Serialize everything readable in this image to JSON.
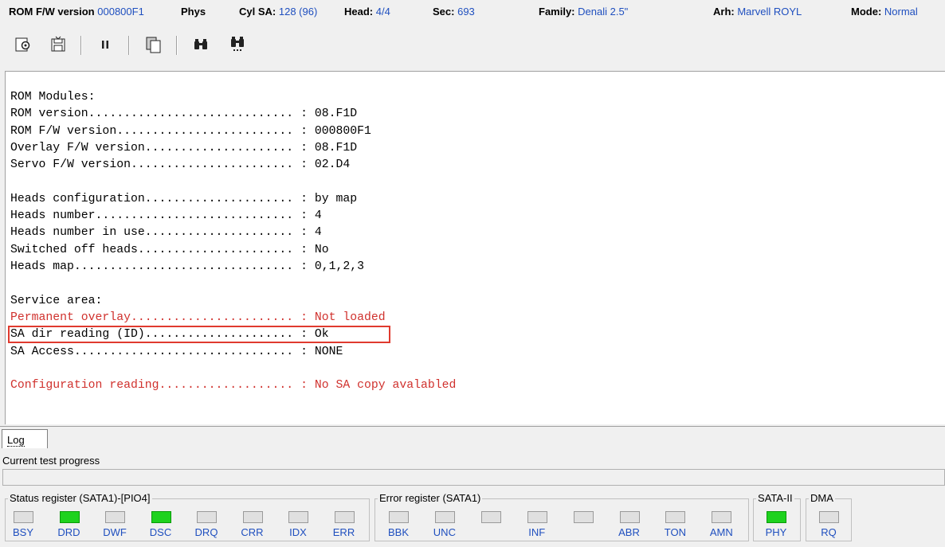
{
  "info": {
    "rom_fw_label": "ROM F/W version",
    "rom_fw_value": "000800F1",
    "phys_label": "Phys",
    "cylsa_label": "Cyl SA:",
    "cylsa_value": "128 (96)",
    "head_label": "Head:",
    "head_value": "4/4",
    "sec_label": "Sec:",
    "sec_value": "693",
    "family_label": "Family:",
    "family_value": "Denali 2.5\"",
    "arh_label": "Arh:",
    "arh_value": "Marvell ROYL",
    "mode_label": "Mode:",
    "mode_value": "Normal"
  },
  "toolbar": {
    "buttons": [
      {
        "name": "settings-icon",
        "glyph": "⚙"
      },
      {
        "name": "save-icon",
        "glyph": "💾"
      },
      {
        "name": "pause-icon",
        "glyph": "⏸"
      },
      {
        "name": "copy-icon",
        "glyph": "❐"
      },
      {
        "name": "binoculars-icon",
        "glyph": "🔭"
      },
      {
        "name": "binoculars-next-icon",
        "glyph": "🔭"
      }
    ]
  },
  "output": {
    "lines": [
      {
        "text": "ROM Modules:",
        "color": "#000000"
      },
      {
        "text": "ROM version............................. : 08.F1D",
        "color": "#000000"
      },
      {
        "text": "ROM F/W version......................... : 000800F1",
        "color": "#000000"
      },
      {
        "text": "Overlay F/W version..................... : 08.F1D",
        "color": "#000000"
      },
      {
        "text": "Servo F/W version....................... : 02.D4",
        "color": "#000000"
      },
      {
        "text": "",
        "color": "#000000"
      },
      {
        "text": "Heads configuration..................... : by map",
        "color": "#000000"
      },
      {
        "text": "Heads number............................ : 4",
        "color": "#000000"
      },
      {
        "text": "Heads number in use..................... : 4",
        "color": "#000000"
      },
      {
        "text": "Switched off heads...................... : No",
        "color": "#000000"
      },
      {
        "text": "Heads map............................... : 0,1,2,3",
        "color": "#000000"
      },
      {
        "text": "",
        "color": "#000000"
      },
      {
        "text": "Service area:",
        "color": "#000000"
      },
      {
        "text": "Permanent overlay....................... : Not loaded",
        "color": "#d0312d"
      },
      {
        "text": "SA dir reading (ID)..................... : Ok",
        "color": "#000000"
      },
      {
        "text": "SA Access............................... : NONE",
        "color": "#000000"
      },
      {
        "text": "",
        "color": "#000000"
      },
      {
        "text": "Configuration reading................... : No SA copy avalabled",
        "color": "#d0312d"
      }
    ]
  },
  "tabs": {
    "log_label": "Log"
  },
  "progress": {
    "label": "Current test progress",
    "value": 0
  },
  "status_register": {
    "title": "Status register (SATA1)-[PIO4]",
    "leds": [
      {
        "label": "BSY",
        "on": false
      },
      {
        "label": "DRD",
        "on": true
      },
      {
        "label": "DWF",
        "on": false
      },
      {
        "label": "DSC",
        "on": true
      },
      {
        "label": "DRQ",
        "on": false
      },
      {
        "label": "CRR",
        "on": false
      },
      {
        "label": "IDX",
        "on": false
      },
      {
        "label": "ERR",
        "on": false
      }
    ]
  },
  "error_register": {
    "title": "Error register (SATA1)",
    "leds": [
      {
        "label": "BBK",
        "on": false
      },
      {
        "label": "UNC",
        "on": false
      },
      {
        "label": "",
        "on": false
      },
      {
        "label": "INF",
        "on": false
      },
      {
        "label": "",
        "on": false
      },
      {
        "label": "ABR",
        "on": false
      },
      {
        "label": "TON",
        "on": false
      },
      {
        "label": "AMN",
        "on": false
      }
    ]
  },
  "sata": {
    "title": "SATA-II",
    "leds": [
      {
        "label": "PHY",
        "on": true
      }
    ]
  },
  "dma": {
    "title": "DMA",
    "leds": [
      {
        "label": "RQ",
        "on": false
      }
    ]
  },
  "colors": {
    "accent_blue": "#1f4fbf",
    "led_on": "#1ed21e",
    "error_red": "#d0312d",
    "highlight_box": "#e03a2e"
  }
}
